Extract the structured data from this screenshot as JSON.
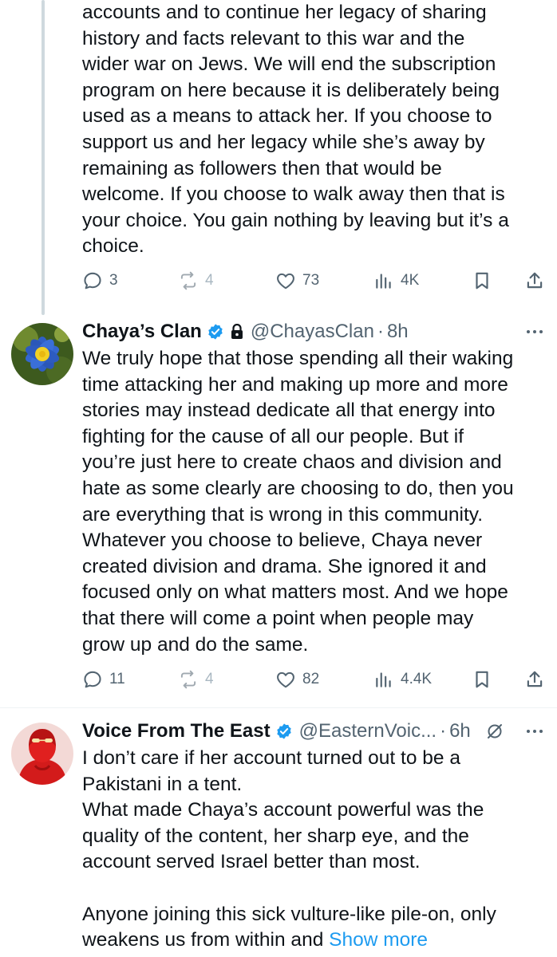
{
  "tweets": [
    {
      "text_lines": [
        "accounts and to continue her legacy of sharing",
        "history and facts relevant to this war and the",
        "wider war on Jews. We will end the subscription",
        "program on here because it is deliberately being",
        "used as a means to attack her. If you choose to",
        "support us and her legacy while she’s away by",
        "remaining as followers then that would be",
        "welcome. If you choose to walk away then that is",
        "your choice. You gain nothing by leaving but it’s a",
        "choice."
      ],
      "replies": "3",
      "retweets": "4",
      "likes": "73",
      "views": "4K"
    },
    {
      "name": "Chaya’s Clan",
      "handle": "@ChayasClan",
      "dot": "·",
      "time": "8h",
      "text_lines": [
        "We truly hope that those spending all their waking",
        "time attacking her and making up more and more",
        "stories may instead dedicate all that energy into",
        "fighting for the cause of all our people. But if",
        "you’re just here to create chaos and division and",
        "hate as some clearly are choosing to do, then you",
        "are everything that is wrong in this community.",
        "Whatever you choose to believe, Chaya never",
        "created division and drama. She ignored it and",
        "focused only on what matters most. And we hope",
        "that there will come a point when people may",
        "grow up and do the same."
      ],
      "replies": "11",
      "retweets": "4",
      "likes": "82",
      "views": "4.4K"
    },
    {
      "name": "Voice From The East",
      "handle": "@EasternVoic...",
      "dot": "·",
      "time": "6h",
      "text_lines": [
        "I don’t care if her account turned out to be a",
        "Pakistani in a tent.",
        "What made Chaya’s account powerful was the",
        "quality of the content, her sharp eye, and the",
        "account served Israel better than most.",
        "",
        "Anyone joining this sick vulture-like pile-on, only"
      ],
      "last_line": "weakens us from within and",
      "show_more": "Show more"
    }
  ],
  "colors": {
    "text": "#0f1419",
    "secondary": "#536471",
    "link": "#1d9bf0",
    "verified": "#1d9bf0",
    "divider": "#eff3f4"
  },
  "icons": [
    "reply-icon",
    "retweet-icon",
    "like-icon",
    "views-icon",
    "bookmark-icon",
    "share-icon",
    "verified-badge-icon",
    "lock-icon",
    "more-icon",
    "grok-icon"
  ]
}
